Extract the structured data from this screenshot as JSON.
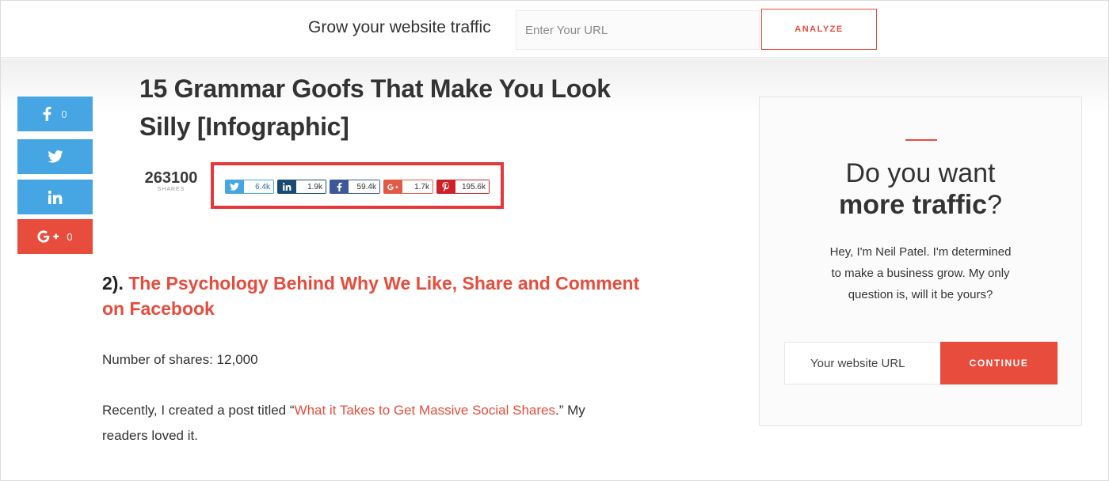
{
  "topbar": {
    "label": "Grow your website traffic",
    "url_placeholder": "Enter Your URL",
    "analyze_label": "ANALYZE"
  },
  "share_sidebar": {
    "facebook": {
      "icon": "facebook-icon",
      "count": "0"
    },
    "twitter": {
      "icon": "twitter-icon"
    },
    "linkedin": {
      "icon": "linkedin-icon"
    },
    "googleplus": {
      "icon": "google-plus-icon",
      "count": "0"
    }
  },
  "article": {
    "title_line1": "15 Grammar Goofs That Make You Look",
    "title_line2": "Silly [Infographic]",
    "total_shares": "263100",
    "total_shares_caption": "SHARES",
    "share_counts": {
      "twitter": "6.4k",
      "linkedin": "1.9k",
      "facebook": "59.4k",
      "googleplus": "1.7k",
      "pinterest": "195.6k"
    },
    "section_number": "2).",
    "section_link_line1": "The Psychology Behind Why We Like, Share and Comment",
    "section_link_line2": "on Facebook",
    "shares_text": "Number of shares: 12,000",
    "para_prefix": "Recently, I created a post titled “",
    "para_link": "What it Takes to Get Massive Social Shares",
    "para_suffix": ".” My",
    "para_line2": "readers loved it."
  },
  "widget": {
    "heading_line1": "Do you want",
    "heading_bold": "more traffic",
    "heading_q": "?",
    "desc_line1": "Hey, I'm Neil Patel. I'm determined",
    "desc_line2": "to make a business grow. My only",
    "desc_line3": "question is, will it be yours?",
    "url_placeholder": "Your website URL",
    "continue_label": "CONTINUE"
  },
  "colors": {
    "accent": "#e74c3c",
    "share_blue": "#46a6e3",
    "highlight_border": "#e5383b"
  }
}
